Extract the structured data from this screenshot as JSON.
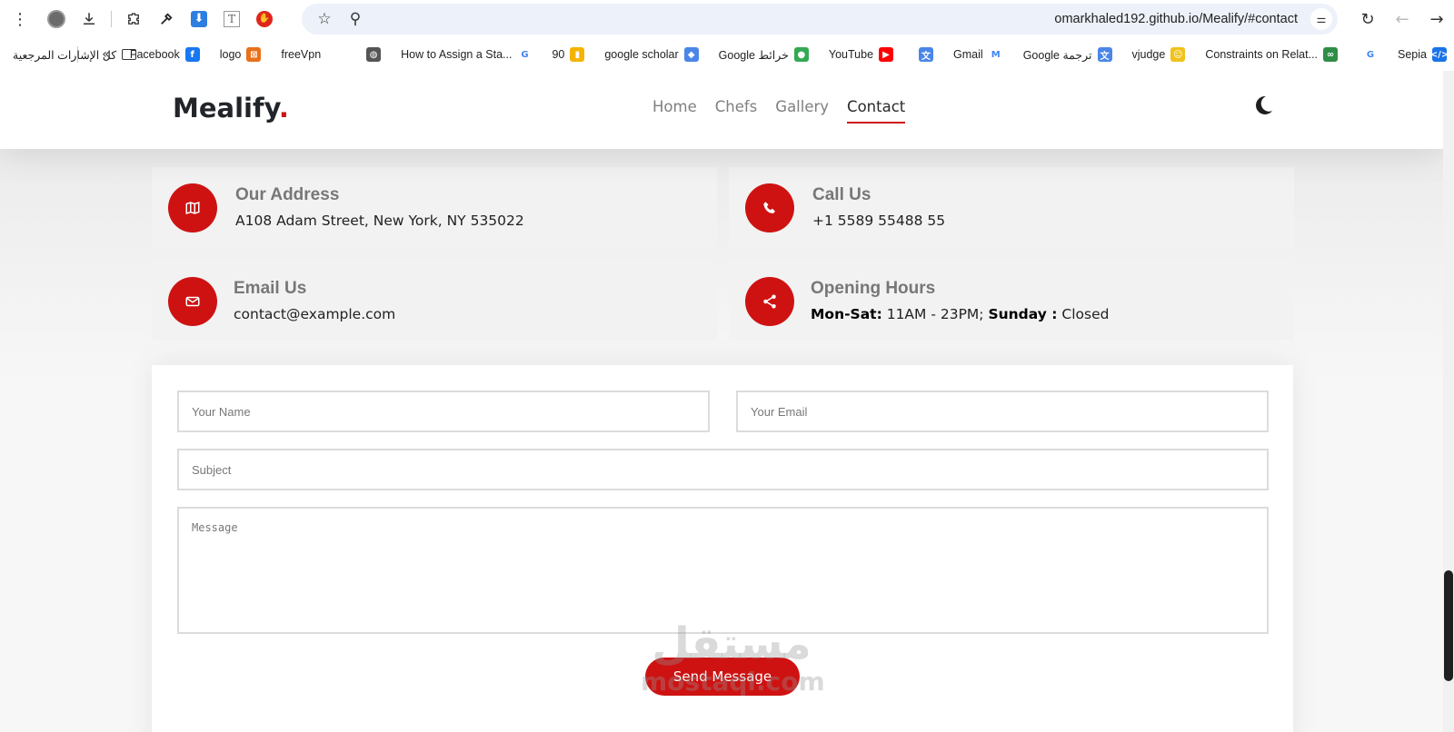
{
  "browser": {
    "url": "omarkhaled192.github.io/Mealify/#contact"
  },
  "bookmarks": {
    "all_bookmarks": "كل الإشارات المرجعية",
    "items": [
      {
        "label": "Sepia",
        "color": "#1a73e8",
        "glyph": "</>"
      },
      {
        "label": "",
        "color": "#ffffff",
        "glyph": "G"
      },
      {
        "label": "Constraints on Relat...",
        "color": "#2f8d46",
        "glyph": "∞"
      },
      {
        "label": "vjudge",
        "color": "#f0c21b",
        "glyph": "☺"
      },
      {
        "label": "Google ترجمة",
        "color": "#4a86e8",
        "glyph": "文"
      },
      {
        "label": "Gmail",
        "color": "#ffffff",
        "glyph": "M"
      },
      {
        "label": "",
        "color": "#4a86e8",
        "glyph": "文"
      },
      {
        "label": "YouTube",
        "color": "#ff0000",
        "glyph": "▶"
      },
      {
        "label": "Google خرائط",
        "color": "#34a853",
        "glyph": "●"
      },
      {
        "label": "google scholar",
        "color": "#4a86e8",
        "glyph": "◆"
      },
      {
        "label": "90",
        "color": "#f4b400",
        "glyph": "▮"
      },
      {
        "label": "How to Assign a Sta...",
        "color": "#ffffff",
        "glyph": "G"
      },
      {
        "label": "",
        "color": "#555555",
        "glyph": "◍"
      },
      {
        "label": "freeVpn",
        "color": "#ffffff",
        "glyph": ""
      },
      {
        "label": "logo",
        "color": "#e8711a",
        "glyph": "⊠"
      },
      {
        "label": "Facebook",
        "color": "#1877f2",
        "glyph": "f"
      }
    ]
  },
  "site": {
    "brand": "Mealify",
    "brand_dot": ".",
    "nav": [
      {
        "label": "Home",
        "active": false
      },
      {
        "label": "Chefs",
        "active": false
      },
      {
        "label": "Gallery",
        "active": false
      },
      {
        "label": "Contact",
        "active": true
      }
    ],
    "accent": "#ce1212"
  },
  "cards": {
    "address": {
      "title": "Our Address",
      "text": "A108 Adam Street, New York, NY 535022",
      "icon": "map-icon"
    },
    "call": {
      "title": "Call Us",
      "text": "+1 5589 55488 55",
      "icon": "phone-icon"
    },
    "email": {
      "title": "Email Us",
      "text": "contact@example.com",
      "icon": "envelope-icon"
    },
    "hours": {
      "title": "Opening Hours",
      "label1": "Mon-Sat:",
      "value1": " 11AM - 23PM; ",
      "label2": "Sunday :",
      "value2": " Closed",
      "icon": "share-icon"
    }
  },
  "form": {
    "name_placeholder": "Your Name",
    "email_placeholder": "Your Email",
    "subject_placeholder": "Subject",
    "message_placeholder": "Message",
    "send_label": "Send Message"
  },
  "watermark": {
    "line1": "مستقل",
    "line2": "mostaql.com"
  }
}
